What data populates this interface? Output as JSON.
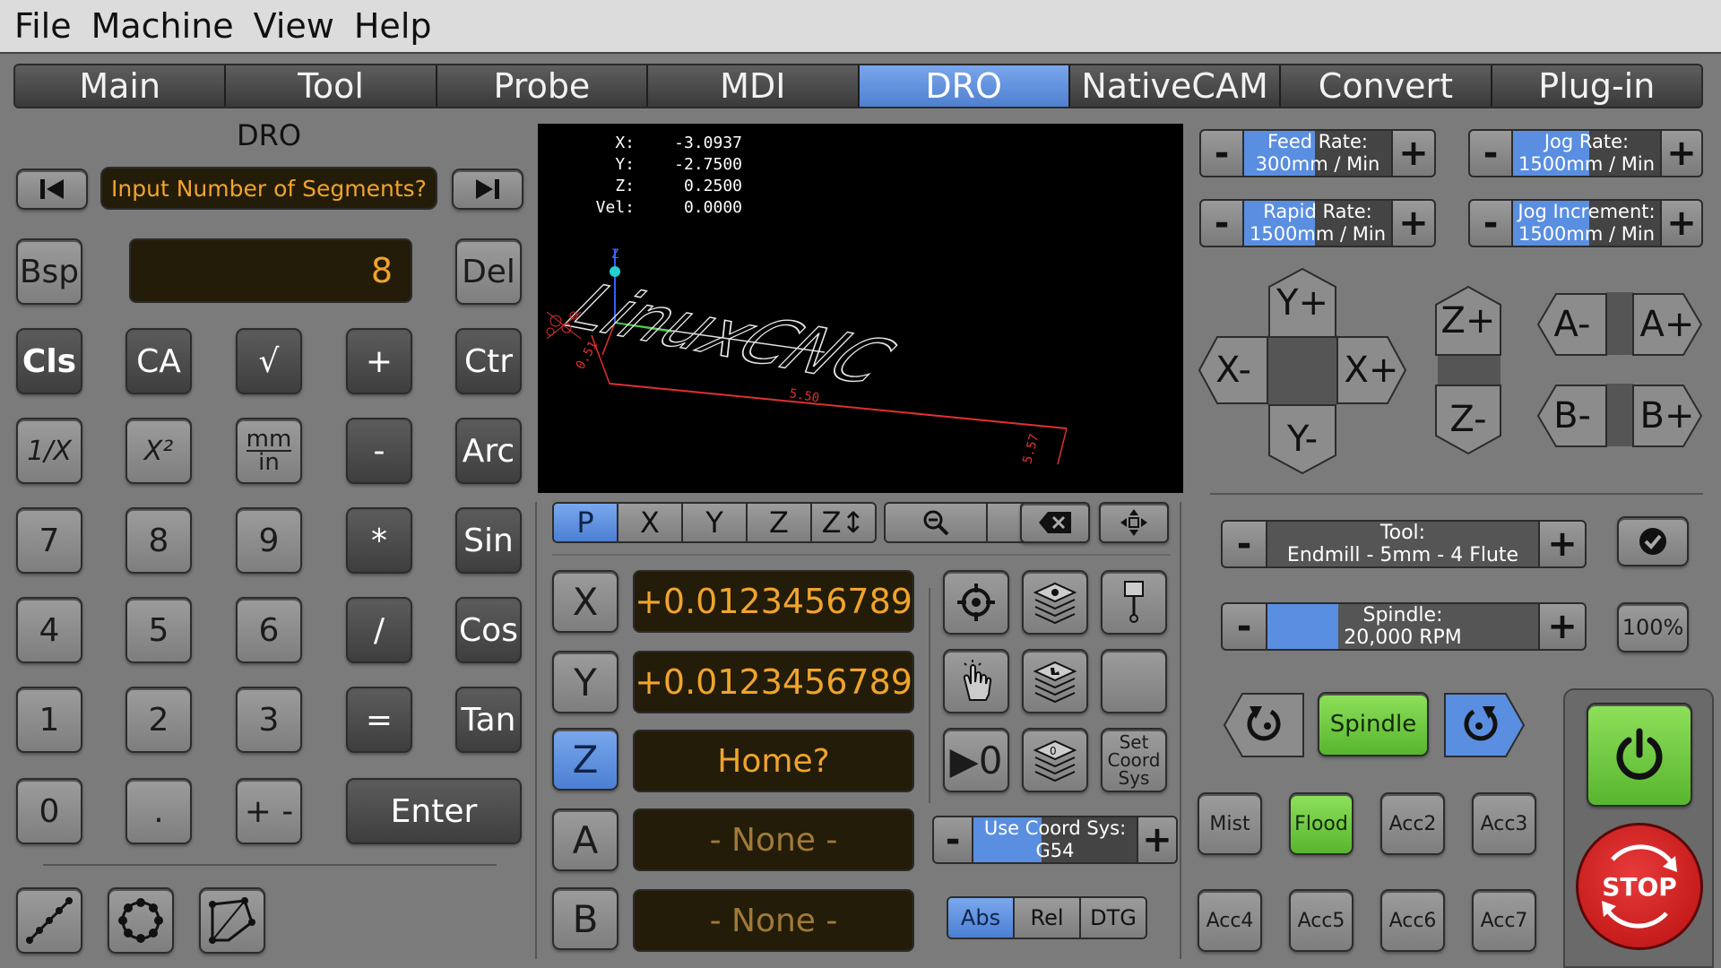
{
  "menu": [
    "File",
    "Machine",
    "View",
    "Help"
  ],
  "tabs": [
    {
      "label": "Main",
      "active": false
    },
    {
      "label": "Tool",
      "active": false
    },
    {
      "label": "Probe",
      "active": false
    },
    {
      "label": "MDI",
      "active": false
    },
    {
      "label": "DRO",
      "active": true
    },
    {
      "label": "NativeCAM",
      "active": false
    },
    {
      "label": "Convert",
      "active": false
    },
    {
      "label": "Plug-in",
      "active": false
    }
  ],
  "calc": {
    "title": "DRO",
    "prompt": "Input Number of Segments?",
    "display": "8",
    "keys": {
      "bsp": "Bsp",
      "del": "Del",
      "cls": "Cls",
      "ca": "CA",
      "sqrt": "√",
      "add": "+",
      "ctr": "Ctr",
      "inv": "1/X",
      "sq": "X²",
      "mm": "mm",
      "in": "in",
      "sub": "-",
      "arc": "Arc",
      "k7": "7",
      "k8": "8",
      "k9": "9",
      "mul": "*",
      "sin": "Sin",
      "k4": "4",
      "k5": "5",
      "k6": "6",
      "div": "/",
      "cos": "Cos",
      "k1": "1",
      "k2": "2",
      "k3": "3",
      "eq": "=",
      "tan": "Tan",
      "k0": "0",
      "dot": ".",
      "pm": "+ -",
      "enter": "Enter"
    }
  },
  "viewer": {
    "dro_labels": [
      "X:",
      "Y:",
      "Z:",
      "Vel:"
    ],
    "dro_values": [
      "-3.0937",
      "-2.7500",
      "0.2500",
      "0.0000"
    ],
    "logo_text": "LinuxCNC",
    "dim_labels": [
      "5.50",
      "5.57",
      "0.51"
    ],
    "axis_z": "Z"
  },
  "view_toolbar": {
    "p": "P",
    "x": "X",
    "y": "Y",
    "z": "Z",
    "z2": "Z↕"
  },
  "axes": [
    {
      "name": "X",
      "value": "+0.0123456789",
      "active": false
    },
    {
      "name": "Y",
      "value": "+0.0123456789",
      "active": false
    },
    {
      "name": "Z",
      "value": "Home?",
      "active": true
    },
    {
      "name": "A",
      "value": "- None -",
      "active": false
    },
    {
      "name": "B",
      "value": "- None -",
      "active": false
    }
  ],
  "coord": {
    "set_line1": "Set",
    "set_line2": "Coord",
    "set_line3": "Sys",
    "zero": "▶0",
    "use_label": "Use Coord Sys:",
    "use_value": "G54",
    "use_fill": 0.42
  },
  "mode": {
    "abs": "Abs",
    "rel": "Rel",
    "dtg": "DTG"
  },
  "rates": {
    "feed": {
      "label": "Feed Rate:",
      "value": "300mm / Min",
      "fill": 0.48
    },
    "jog": {
      "label": "Jog Rate:",
      "value": "1500mm / Min",
      "fill": 0.52
    },
    "rapid": {
      "label": "Rapid Rate:",
      "value": "1500mm / Min",
      "fill": 0.48
    },
    "jog_inc": {
      "label": "Jog Increment:",
      "value": "1500mm / Min",
      "fill": 0.52
    }
  },
  "jog": {
    "yp": "Y+",
    "ym": "Y-",
    "xm": "X-",
    "xp": "X+",
    "zp": "Z+",
    "zm": "Z-",
    "am": "A-",
    "ap": "A+",
    "bm": "B-",
    "bp": "B+"
  },
  "tool": {
    "label": "Tool:",
    "value": "Endmill -  5mm - 4 Flute"
  },
  "spindle": {
    "label": "Spindle:",
    "value": "20,000 RPM",
    "fill": 0.26,
    "pct": "100%",
    "btn": "Spindle"
  },
  "acc": {
    "mist": "Mist",
    "flood": "Flood",
    "acc2": "Acc2",
    "acc3": "Acc3",
    "acc4": "Acc4",
    "acc5": "Acc5",
    "acc6": "Acc6",
    "acc7": "Acc7"
  },
  "stop": "STOP",
  "colors": {
    "accent": "#5a8ee0",
    "amber": "#f0a42c",
    "green": "#6cc83c",
    "stop_red": "#c81818"
  }
}
